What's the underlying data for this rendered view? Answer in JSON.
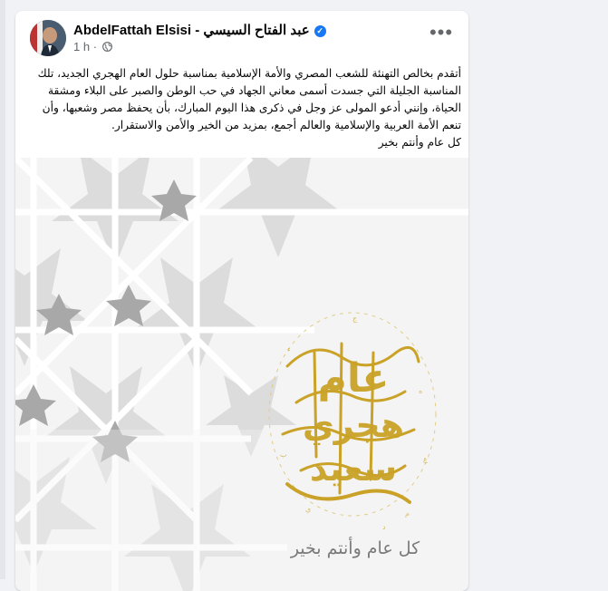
{
  "post": {
    "author_name": "AbdelFattah Elsisi - عبد الفتاح السيسي",
    "verified_icon": "verified-badge-icon",
    "timestamp": "1 h",
    "separator": "·",
    "privacy_icon": "globe-icon",
    "more_icon": "more-options-icon",
    "more_label": "•••",
    "text_lines": [
      "أتقدم بخالص التهنئة للشعب المصري والأمة الإسلامية بمناسبة حلول العام الهجري الجديد، تلك المناسبة الجليلة التي جسدت أسمى معاني الجهاد في حب الوطن والصبر على البلاء ومشقة الحياة، وإنني أدعو المولى عز وجل في ذكرى هذا اليوم المبارك، بأن يحفظ مصر وشعبها، وأن تنعم الأمة العربية والإسلامية والعالم أجمع، بمزيد من الخير والأمن والاستقرار.",
      "كل عام وأنتم بخير"
    ],
    "image": {
      "calligraphy_text": "عام هجري سعيد",
      "caption": "كل عام وأنتم بخير",
      "colors": {
        "background": "#f4f4f4",
        "pattern_light": "#dcdcdc",
        "pattern_dark": "#9a9a9a",
        "gold": "#c9a227"
      }
    }
  },
  "colors": {
    "page_background": "#f0f2f5",
    "card": "#ffffff",
    "secondary_text": "#65676b",
    "verified_blue": "#1877f2"
  }
}
